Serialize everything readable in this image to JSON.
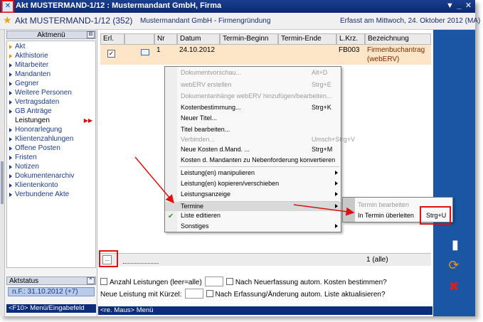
{
  "window": {
    "title": "Akt MUSTERMAND-1/12 : Mustermandant GmbH, Firma",
    "controls": {
      "restore": "▼",
      "minimize": "_",
      "close": "✕"
    }
  },
  "header": {
    "case": "Akt MUSTERMAND-1/12 (352)",
    "company": "Mustermandant GmbH - Firmengründung",
    "created": "Erfasst am Mittwoch, 24. Oktober 2012 (MA)"
  },
  "sidebar": {
    "title": "Aktmenü",
    "items": [
      {
        "label": "Akt"
      },
      {
        "label": "Akthistorie"
      },
      {
        "label": "Mitarbeiter"
      },
      {
        "label": "Mandanten"
      },
      {
        "label": "Gegner"
      },
      {
        "label": "Weitere Personen"
      },
      {
        "label": "Vertragsdaten"
      },
      {
        "label": "GB Anträge"
      },
      {
        "label": "Leistungen"
      },
      {
        "label": "Honorarlegung"
      },
      {
        "label": "Klientenzahlungen"
      },
      {
        "label": "Offene Posten"
      },
      {
        "label": "Fristen"
      },
      {
        "label": "Notizen"
      },
      {
        "label": "Dokumentenarchiv"
      },
      {
        "label": "Klientenkonto"
      },
      {
        "label": "Verbundene Akte"
      }
    ],
    "status_title": "Aktstatus",
    "status_badge": "n.F.: 31.10.2012 (+7)",
    "f10_hint": "<F10> Menü/Eingabefeld"
  },
  "grid": {
    "columns": [
      "Erl.",
      "",
      "Nr",
      "Datum",
      "Termin-Beginn",
      "Termin-Ende",
      "L.Krz.",
      "Bezeichnung"
    ],
    "rows": [
      {
        "nr": "1",
        "datum": "24.10.2012",
        "beginn": "",
        "ende": "",
        "lkrz": "FB003",
        "bezeichnung": "Firmenbuchantrag (webERV)"
      }
    ],
    "count": "1 (alle)",
    "dots_label": "..."
  },
  "options": {
    "anzahl": "Anzahl Leistungen (leer=alle)",
    "neuerfassung": "Nach Neuerfassung autom. Kosten bestimmen?",
    "kuerzel": "Neue Leistung mit Kürzel:",
    "aenderung": "Nach Erfassung/Änderung autom. Liste aktualisieren?",
    "hint": "<re. Maus> Menü"
  },
  "context_menu": {
    "items": [
      {
        "label": "Dokumentvorschau...",
        "shortcut": "Alt+D",
        "disabled": true
      },
      {
        "label": "webERV erstellen",
        "shortcut": "Strg+E",
        "disabled": true
      },
      {
        "label": "Dokumentanhänge webERV hinzufügen/bearbeiten...",
        "shortcut": "",
        "disabled": true
      },
      {
        "label": "Kostenbestimmung...",
        "shortcut": "Strg+K",
        "disabled": false
      },
      {
        "label": "Neuer Titel...",
        "shortcut": "",
        "disabled": false
      },
      {
        "label": "Titel bearbeiten...",
        "shortcut": "",
        "disabled": false
      },
      {
        "label": "Verbinden...",
        "shortcut": "Umsch+Strg+V",
        "disabled": true
      },
      {
        "label": "Neue Kosten d.Mand. ...",
        "shortcut": "Strg+M",
        "disabled": false
      },
      {
        "label": "Kosten d. Mandanten zu Nebenforderung konvertieren",
        "shortcut": "",
        "disabled": false
      },
      {
        "label": "Leistung(en) manipulieren",
        "shortcut": "",
        "disabled": false
      },
      {
        "label": "Leistung(en) kopieren/verschieben",
        "shortcut": "",
        "disabled": false
      },
      {
        "label": "Leistungsanzeige",
        "shortcut": "",
        "disabled": false
      },
      {
        "label": "Termine",
        "shortcut": "",
        "disabled": false
      },
      {
        "label": "Liste editieren",
        "shortcut": "",
        "disabled": false
      },
      {
        "label": "Sonstiges",
        "shortcut": "",
        "disabled": false
      }
    ],
    "submenu": [
      {
        "label": "Termin bearbeiten",
        "shortcut": "",
        "disabled": true
      },
      {
        "label": "In Termin überleiten",
        "shortcut": "Strg+U",
        "disabled": false
      }
    ]
  },
  "colors": {
    "titlebar": "#0a2a6e",
    "row_highlight": "#fde6c8",
    "annotation_red": "#e01010",
    "right_strip": "#1a56a3"
  }
}
